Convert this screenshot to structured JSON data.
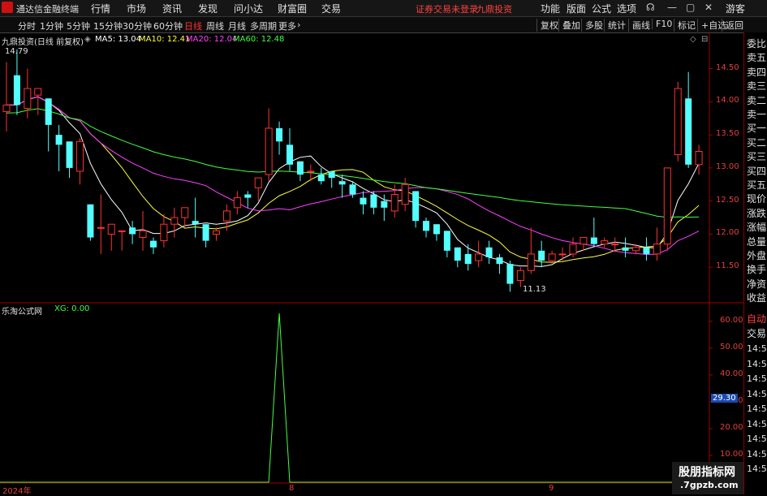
{
  "app": {
    "title": "通达信金融终端",
    "menu": [
      "行情",
      "市场",
      "资讯",
      "发现",
      "问小达",
      "财富圈",
      "交易"
    ],
    "broker_notice": "证券交易未登录",
    "broker_name": "九鼎投资",
    "right_menu": [
      "功能",
      "版面",
      "公式",
      "选项"
    ],
    "guest": "游客"
  },
  "toolbar": {
    "periods": [
      "分时",
      "1分钟",
      "5分钟",
      "15分钟",
      "30分钟",
      "60分钟",
      "日线",
      "周线",
      "月线",
      "多周期",
      "更多"
    ],
    "active_period": "日线",
    "tools": [
      "复权",
      "叠加",
      "多股",
      "统计",
      "画线",
      "F10",
      "标记",
      "+自选",
      "返回"
    ]
  },
  "main_chart": {
    "stock_label": "九鼎投资(日线 前复权)",
    "ma": [
      {
        "label": "MA5: 13.04",
        "color": "#ffffff"
      },
      {
        "label": "MA10: 12.41",
        "color": "#ffff40"
      },
      {
        "label": "MA20: 12.04",
        "color": "#ff40ff"
      },
      {
        "label": "MA60: 12.48",
        "color": "#40ff40"
      }
    ],
    "high_mark": "14.79",
    "low_mark": "11.13",
    "y_ticks": [
      "14.50",
      "14.00",
      "13.50",
      "13.00",
      "12.50",
      "12.00",
      "11.50"
    ]
  },
  "indicator": {
    "name": "乐淘公式网",
    "value_label": "XG: 0.00",
    "y_ticks": [
      "60.00",
      "50.00",
      "40.00",
      "30.00",
      "20.00",
      "10.00"
    ],
    "cursor_value": "29.30"
  },
  "x_axis": {
    "labels": [
      "2024年",
      "8",
      "9"
    ]
  },
  "side_panel": {
    "labels": [
      "委比",
      "卖五",
      "卖四",
      "卖三",
      "卖二",
      "卖一",
      "买一",
      "买二",
      "买三",
      "买四",
      "买五",
      "现价",
      "涨跌",
      "涨幅",
      "总量",
      "外盘",
      "换手",
      "净资",
      "收益"
    ],
    "auto": "自动",
    "trade": "交易",
    "times": [
      "14:55",
      "14:55",
      "14:56",
      "14:56",
      "14:56",
      "14:56",
      "14:56",
      "14:56",
      "14:56"
    ]
  },
  "watermark": {
    "line1": "股朋指标网",
    "line2": ".7gpzb.com"
  },
  "chart_data": {
    "type": "candlestick",
    "ylim": [
      11.0,
      14.85
    ],
    "candles": [
      [
        13.85,
        13.95,
        13.55,
        14.6
      ],
      [
        14.4,
        13.95,
        13.8,
        14.79
      ],
      [
        13.9,
        14.2,
        13.75,
        14.5
      ],
      [
        14.1,
        14.2,
        13.8,
        14.1
      ],
      [
        14.05,
        13.65,
        13.25,
        14.05
      ],
      [
        13.5,
        13.35,
        12.95,
        13.65
      ],
      [
        13.4,
        13.0,
        12.85,
        13.4
      ],
      [
        12.95,
        13.4,
        12.75,
        13.45
      ],
      [
        12.45,
        11.95,
        11.9,
        12.45
      ],
      [
        12.1,
        12.1,
        11.7,
        12.6
      ],
      [
        12.0,
        12.15,
        11.75,
        12.1
      ],
      [
        12.05,
        12.05,
        11.75,
        12.05
      ],
      [
        12.1,
        12.0,
        11.85,
        12.2
      ],
      [
        11.95,
        12.05,
        11.75,
        12.35
      ],
      [
        11.9,
        11.8,
        11.7,
        11.95
      ],
      [
        11.9,
        12.15,
        11.8,
        12.3
      ],
      [
        12.15,
        12.25,
        11.95,
        12.4
      ],
      [
        12.25,
        12.4,
        12.1,
        12.4
      ],
      [
        12.2,
        12.15,
        11.95,
        12.55
      ],
      [
        12.15,
        11.9,
        11.8,
        12.15
      ],
      [
        12.0,
        12.05,
        11.9,
        12.1
      ],
      [
        12.2,
        12.35,
        12.05,
        12.45
      ],
      [
        12.4,
        12.55,
        12.3,
        12.65
      ],
      [
        12.6,
        12.55,
        12.4,
        12.65
      ],
      [
        12.7,
        12.85,
        12.5,
        12.85
      ],
      [
        12.9,
        13.6,
        12.8,
        13.9
      ],
      [
        13.6,
        13.4,
        13.2,
        13.7
      ],
      [
        13.35,
        13.05,
        12.95,
        13.6
      ],
      [
        13.1,
        12.9,
        12.8,
        13.1
      ],
      [
        12.95,
        12.95,
        12.8,
        13.05
      ],
      [
        12.9,
        12.8,
        12.75,
        13.0
      ],
      [
        12.95,
        12.85,
        12.7,
        12.95
      ],
      [
        12.8,
        12.75,
        12.55,
        12.9
      ],
      [
        12.75,
        12.6,
        12.55,
        12.8
      ],
      [
        12.55,
        12.45,
        12.3,
        12.65
      ],
      [
        12.6,
        12.4,
        12.3,
        12.65
      ],
      [
        12.5,
        12.4,
        12.2,
        12.6
      ],
      [
        12.35,
        12.6,
        12.25,
        12.75
      ],
      [
        12.45,
        12.75,
        12.35,
        12.85
      ],
      [
        12.65,
        12.2,
        12.1,
        12.65
      ],
      [
        12.2,
        12.05,
        11.95,
        12.25
      ],
      [
        12.15,
        12.0,
        11.9,
        12.15
      ],
      [
        12.05,
        11.75,
        11.65,
        12.05
      ],
      [
        11.8,
        11.6,
        11.5,
        11.8
      ],
      [
        11.7,
        11.55,
        11.45,
        11.85
      ],
      [
        11.6,
        11.7,
        11.5,
        11.9
      ],
      [
        11.8,
        11.65,
        11.55,
        11.9
      ],
      [
        11.65,
        11.55,
        11.4,
        11.7
      ],
      [
        11.55,
        11.25,
        11.13,
        11.6
      ],
      [
        11.3,
        11.45,
        11.2,
        11.5
      ],
      [
        11.45,
        11.7,
        11.4,
        12.1
      ],
      [
        11.75,
        11.6,
        11.5,
        11.9
      ],
      [
        11.6,
        11.7,
        11.55,
        11.75
      ],
      [
        11.7,
        11.7,
        11.6,
        11.8
      ],
      [
        11.7,
        11.85,
        11.65,
        11.95
      ],
      [
        11.85,
        11.95,
        11.75,
        11.95
      ],
      [
        11.95,
        11.85,
        11.8,
        12.25
      ],
      [
        11.85,
        11.9,
        11.8,
        11.95
      ],
      [
        11.85,
        11.85,
        11.75,
        11.95
      ],
      [
        11.8,
        11.75,
        11.65,
        11.95
      ],
      [
        11.75,
        11.8,
        11.7,
        11.85
      ],
      [
        11.8,
        11.7,
        11.6,
        11.95
      ],
      [
        11.7,
        11.85,
        11.6,
        12.1
      ],
      [
        11.85,
        13.0,
        11.75,
        13.0
      ],
      [
        13.2,
        14.2,
        13.1,
        14.3
      ],
      [
        14.05,
        13.05,
        13.0,
        14.45
      ],
      [
        13.05,
        13.25,
        12.9,
        13.35
      ]
    ],
    "indicator_series": {
      "name": "XG",
      "spike_index": 26,
      "spike_value": 63
    }
  }
}
